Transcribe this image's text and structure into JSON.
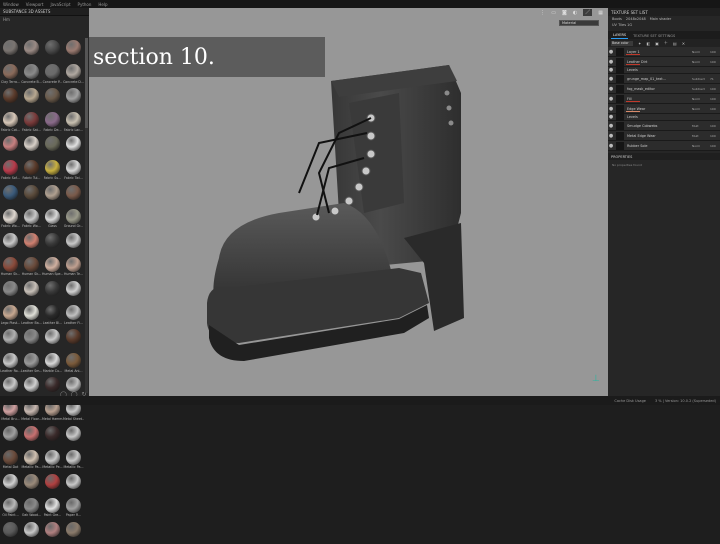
{
  "menu": [
    "Window",
    "Viewport",
    "JavaScript",
    "Python",
    "Help"
  ],
  "shelf": {
    "title": "SUBSTANCE 3D ASSETS",
    "filter": "Hm",
    "assets": [
      {
        "label": "",
        "color": "#7a7470"
      },
      {
        "label": "",
        "color": "#9a8a84"
      },
      {
        "label": "",
        "color": "#4a4a4a"
      },
      {
        "label": "",
        "color": "#9a7a70"
      },
      {
        "label": "Clay Terra...",
        "color": "#8a6a5a"
      },
      {
        "label": "Concrete B...",
        "color": "#8a8a8a"
      },
      {
        "label": "Concrete P...",
        "color": "#6a6a6a"
      },
      {
        "label": "Concrete D...",
        "color": "#b0a8a0"
      },
      {
        "label": "",
        "color": "#5a3a2a"
      },
      {
        "label": "",
        "color": "#b8a890"
      },
      {
        "label": "",
        "color": "#6a5a4a"
      },
      {
        "label": "",
        "color": "#a0a0a0"
      },
      {
        "label": "Fabric Cot...",
        "color": "#d8c8b8"
      },
      {
        "label": "Fabric Sat...",
        "color": "#7a3a3a"
      },
      {
        "label": "Fabric De...",
        "color": "#8a6a8a"
      },
      {
        "label": "Fabric Lac...",
        "color": "#c8c0b0"
      },
      {
        "label": "",
        "color": "#c88080"
      },
      {
        "label": "",
        "color": "#d8d0c8"
      },
      {
        "label": "",
        "color": "#6a6a5a"
      },
      {
        "label": "",
        "color": "#e0e0e0"
      },
      {
        "label": "Fabric Sof...",
        "color": "#b83a4a"
      },
      {
        "label": "Fabric Tul...",
        "color": "#5a3a2a"
      },
      {
        "label": "Fabric Su...",
        "color": "#c8b040"
      },
      {
        "label": "Fabric Twi...",
        "color": "#d8d8d8"
      },
      {
        "label": "",
        "color": "#3a5a7a"
      },
      {
        "label": "",
        "color": "#5a4a3a"
      },
      {
        "label": "",
        "color": "#b0a090"
      },
      {
        "label": "",
        "color": "#7a5a4a"
      },
      {
        "label": "Fabric Wo...",
        "color": "#e0d8d0"
      },
      {
        "label": "Fabric Wo...",
        "color": "#c8c8c8"
      },
      {
        "label": "Glass",
        "color": "#d8d8d8"
      },
      {
        "label": "Ground Gr...",
        "color": "#9a9a8a"
      },
      {
        "label": "",
        "color": "#c8c8c8"
      },
      {
        "label": "",
        "color": "#d08070"
      },
      {
        "label": "",
        "color": "#3a3a3a"
      },
      {
        "label": "",
        "color": "#c8c8c8"
      },
      {
        "label": "Human Sk...",
        "color": "#8a4a3a"
      },
      {
        "label": "Human Sk...",
        "color": "#6a4a3a"
      },
      {
        "label": "Human Spe...",
        "color": "#d0b0a0"
      },
      {
        "label": "Human Te...",
        "color": "#c0a090"
      },
      {
        "label": "",
        "color": "#8a8a8a"
      },
      {
        "label": "",
        "color": "#c8c0b8"
      },
      {
        "label": "",
        "color": "#3a3a3a"
      },
      {
        "label": "",
        "color": "#d0d0d0"
      },
      {
        "label": "Lego Plast...",
        "color": "#c8a890"
      },
      {
        "label": "Leather Ba...",
        "color": "#e0e0d8"
      },
      {
        "label": "Leather Bl...",
        "color": "#2a2a2a"
      },
      {
        "label": "Leather Fi...",
        "color": "#c0c0c0"
      },
      {
        "label": "",
        "color": "#b0b0b0"
      },
      {
        "label": "",
        "color": "#8a8a8a"
      },
      {
        "label": "",
        "color": "#c8c8c8"
      },
      {
        "label": "",
        "color": "#5a3a2a"
      },
      {
        "label": "Leather Ro...",
        "color": "#c8c8c8"
      },
      {
        "label": "Leather Sm...",
        "color": "#9a9a9a"
      },
      {
        "label": "Marble Cu...",
        "color": "#d8d8d8"
      },
      {
        "label": "Metal Ani...",
        "color": "#7a5a3a"
      },
      {
        "label": "",
        "color": "#c8c8c8"
      },
      {
        "label": "",
        "color": "#d0d0d0"
      },
      {
        "label": "",
        "color": "#3a2a2a"
      },
      {
        "label": "",
        "color": "#c0c0c0"
      },
      {
        "label": "Metal Bru...",
        "color": "#d0a0a0"
      },
      {
        "label": "Metal Floor...",
        "color": "#c8b8b0"
      },
      {
        "label": "Metal Hamm...",
        "color": "#b8a090"
      },
      {
        "label": "Metal Sheet...",
        "color": "#c8c8c8"
      },
      {
        "label": "",
        "color": "#a0a0a0"
      },
      {
        "label": "",
        "color": "#c87070"
      },
      {
        "label": "",
        "color": "#3a2a2a"
      },
      {
        "label": "",
        "color": "#c8c8c8"
      },
      {
        "label": "Metal Dot",
        "color": "#6a4a3a"
      },
      {
        "label": "Metallic Pa...",
        "color": "#d0c0b0"
      },
      {
        "label": "Metallic Pe...",
        "color": "#c8c8c8"
      },
      {
        "label": "Metallic Pa...",
        "color": "#c8c8c8"
      },
      {
        "label": "",
        "color": "#d0d0d0"
      },
      {
        "label": "",
        "color": "#9a8a7a"
      },
      {
        "label": "",
        "color": "#b04040"
      },
      {
        "label": "",
        "color": "#c8c8c8"
      },
      {
        "label": "Oil Paint...",
        "color": "#b8b8b8"
      },
      {
        "label": "Oak Wood...",
        "color": "#8a8a8a"
      },
      {
        "label": "Paint Gre...",
        "color": "#e0e0e0"
      },
      {
        "label": "Paper R...",
        "color": "#a0a0a0"
      },
      {
        "label": "",
        "color": "#5a5a5a"
      },
      {
        "label": "",
        "color": "#c8c8c8"
      },
      {
        "label": "",
        "color": "#b08080"
      },
      {
        "label": "",
        "color": "#8a7a6a"
      }
    ]
  },
  "viewport": {
    "view_mode": "Material",
    "caption": "section 10."
  },
  "texture_set_list": {
    "title": "TEXTURE SET LIST",
    "rows": [
      {
        "name": "Boots",
        "resolution": "2048x2048",
        "shader": "Main shader"
      },
      {
        "name": "UV Tiles 1G"
      }
    ]
  },
  "layers": {
    "tabs": [
      "LAYERS",
      "TEXTURE SET SETTINGS"
    ],
    "blend_mode": "Base color",
    "items": [
      {
        "name": "Layer 1",
        "blend": "Norm",
        "opacity": "100",
        "bar": "red"
      },
      {
        "name": "Leather Dirt",
        "blend": "Norm",
        "opacity": "100",
        "bar": "red"
      },
      {
        "name": "Levels",
        "blend": "",
        "opacity": "",
        "bar": ""
      },
      {
        "name": "grunge_map_01_text...",
        "blend": "Subtract",
        "opacity": "71",
        "bar": ""
      },
      {
        "name": "fog_mask_editor",
        "blend": "Subtract",
        "opacity": "100",
        "bar": ""
      },
      {
        "name": "Fill",
        "blend": "Norm",
        "opacity": "100",
        "bar": "red"
      },
      {
        "name": "Edge Wear",
        "blend": "Norm",
        "opacity": "100",
        "bar": "pink"
      },
      {
        "name": "Levels",
        "blend": "",
        "opacity": "",
        "bar": ""
      },
      {
        "name": "Smudge Cobwebs",
        "blend": "Mult",
        "opacity": "100",
        "bar": ""
      },
      {
        "name": "Metal Edge Wear",
        "blend": "Mult",
        "opacity": "100",
        "bar": ""
      },
      {
        "name": "Rubber Sole",
        "blend": "Norm",
        "opacity": "100",
        "bar": ""
      }
    ]
  },
  "properties": {
    "title": "PROPERTIES",
    "hint": "No properties found"
  },
  "status": [
    "Cache Disk Usage",
    "3 % | Version: 10.0.2 (Superseded)"
  ]
}
